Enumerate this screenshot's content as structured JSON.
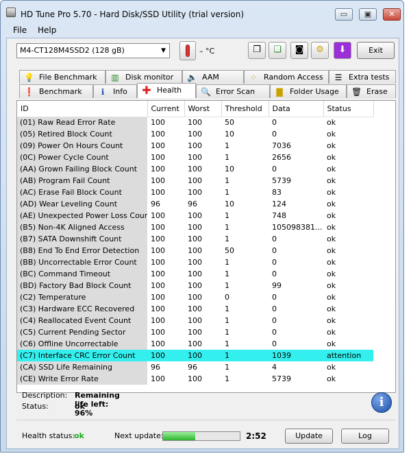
{
  "window": {
    "title": "HD Tune Pro 5.70 - Hard Disk/SSD Utility (trial version)",
    "minimize_glyph": "▭",
    "restore_glyph": "▣",
    "close_glyph": "✕"
  },
  "menu": {
    "file": "File",
    "help": "Help"
  },
  "toolbar": {
    "drive": "M4-CT128M4SSD2 (128 gB)",
    "temperature": "– °C",
    "exit": "Exit"
  },
  "tabs_top": [
    "File Benchmark",
    "Disk monitor",
    "AAM",
    "Random Access",
    "Extra tests"
  ],
  "tabs_bottom": [
    "Benchmark",
    "Info",
    "Health",
    "Error Scan",
    "Folder Usage",
    "Erase"
  ],
  "table": {
    "headers": [
      "ID",
      "Current",
      "Worst",
      "Threshold",
      "Data",
      "Status"
    ],
    "rows": [
      [
        "(01) Raw Read Error Rate",
        "100",
        "100",
        "50",
        "0",
        "ok"
      ],
      [
        "(05) Retired Block Count",
        "100",
        "100",
        "10",
        "0",
        "ok"
      ],
      [
        "(09) Power On Hours Count",
        "100",
        "100",
        "1",
        "7036",
        "ok"
      ],
      [
        "(0C) Power Cycle Count",
        "100",
        "100",
        "1",
        "2656",
        "ok"
      ],
      [
        "(AA) Grown Failing Block Count",
        "100",
        "100",
        "10",
        "0",
        "ok"
      ],
      [
        "(AB) Program Fail Count",
        "100",
        "100",
        "1",
        "5739",
        "ok"
      ],
      [
        "(AC) Erase Fail Block Count",
        "100",
        "100",
        "1",
        "83",
        "ok"
      ],
      [
        "(AD) Wear Leveling Count",
        "96",
        "96",
        "10",
        "124",
        "ok"
      ],
      [
        "(AE) Unexpected Power Loss Count",
        "100",
        "100",
        "1",
        "748",
        "ok"
      ],
      [
        "(B5) Non-4K Aligned Access",
        "100",
        "100",
        "1",
        "105098381...",
        "ok"
      ],
      [
        "(B7) SATA Downshift Count",
        "100",
        "100",
        "1",
        "0",
        "ok"
      ],
      [
        "(B8) End To End Error Detection",
        "100",
        "100",
        "50",
        "0",
        "ok"
      ],
      [
        "(BB) Uncorrectable Error Count",
        "100",
        "100",
        "1",
        "0",
        "ok"
      ],
      [
        "(BC) Command Timeout",
        "100",
        "100",
        "1",
        "0",
        "ok"
      ],
      [
        "(BD) Factory Bad Block Count",
        "100",
        "100",
        "1",
        "99",
        "ok"
      ],
      [
        "(C2) Temperature",
        "100",
        "100",
        "0",
        "0",
        "ok"
      ],
      [
        "(C3) Hardware ECC Recovered",
        "100",
        "100",
        "1",
        "0",
        "ok"
      ],
      [
        "(C4) Reallocated Event Count",
        "100",
        "100",
        "1",
        "0",
        "ok"
      ],
      [
        "(C5) Current Pending Sector",
        "100",
        "100",
        "1",
        "0",
        "ok"
      ],
      [
        "(C6) Offline Uncorrectable",
        "100",
        "100",
        "1",
        "0",
        "ok"
      ],
      [
        "(C7) Interface CRC Error Count",
        "100",
        "100",
        "1",
        "1039",
        "attention"
      ],
      [
        "(CA) SSD Life Remaining",
        "96",
        "96",
        "1",
        "4",
        "ok"
      ],
      [
        "(CE) Write Error Rate",
        "100",
        "100",
        "1",
        "5739",
        "ok"
      ]
    ],
    "highlight_row": 20,
    "highlight_color": "#33f0ee"
  },
  "description": {
    "label": "Description:",
    "value": "Remaining life left: 96%",
    "status_label": "Status:",
    "status_value": "ok"
  },
  "footer": {
    "health_label": "Health status:",
    "health_value": "ok",
    "next_update_label": "Next update:",
    "progress": 0.42,
    "countdown": "2:52",
    "update": "Update",
    "log": "Log"
  },
  "colors": {
    "accent_ok": "#1faa1f",
    "attention": "#33f0ee"
  }
}
